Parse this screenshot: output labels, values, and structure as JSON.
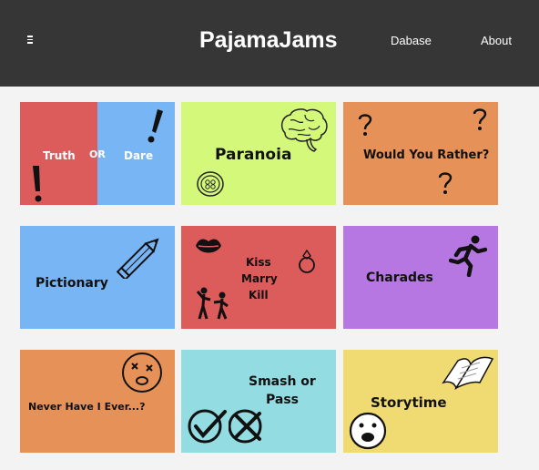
{
  "header": {
    "brand": "PajamaJams",
    "menu_icon": "hamburger-icon",
    "links": [
      "Dabase",
      "About"
    ]
  },
  "games": {
    "truth_or_dare": {
      "truth": "Truth",
      "or": "OR",
      "dare": "Dare"
    },
    "paranoia": "Paranoia",
    "would_you_rather": "Would You Rather?",
    "pictionary": "Pictionary",
    "kiss_marry_kill": {
      "kiss": "Kiss",
      "marry": "Marry",
      "kill": "Kill"
    },
    "charades": "Charades",
    "never_have_i_ever": "Never Have I Ever...?",
    "smash_or_pass": {
      "line1": "Smash or",
      "line2": "Pass"
    },
    "storytime": "Storytime"
  },
  "colors": {
    "header_bg": "#363636",
    "page_bg": "#f3f3f3",
    "red": "#dc5b5b",
    "blue": "#78b5f5",
    "lime": "#d4f97a",
    "orange": "#e69158",
    "purple": "#b777e3",
    "cyan": "#93dde2",
    "yellow": "#f0da72"
  }
}
